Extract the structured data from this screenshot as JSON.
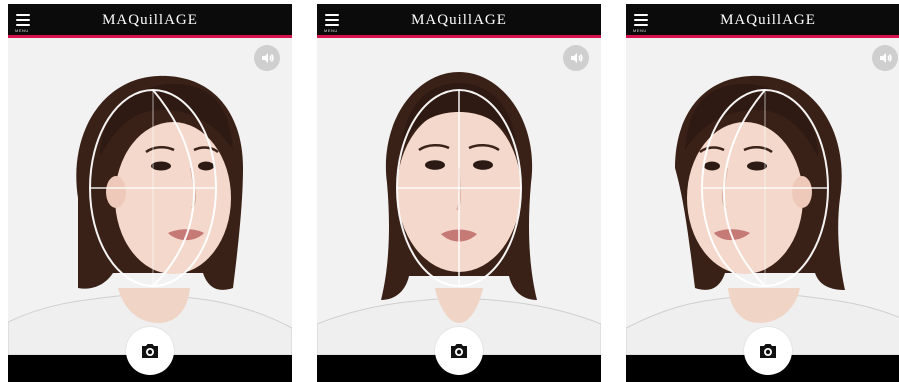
{
  "screens": [
    {
      "brand": "MAQuillAGE",
      "menu_label": "MENU",
      "sound_icon": "speaker-icon",
      "camera_icon": "camera-icon",
      "pose": "turned-left"
    },
    {
      "brand": "MAQuillAGE",
      "menu_label": "MENU",
      "sound_icon": "speaker-icon",
      "camera_icon": "camera-icon",
      "pose": "front"
    },
    {
      "brand": "MAQuillAGE",
      "menu_label": "MENU",
      "sound_icon": "speaker-icon",
      "camera_icon": "camera-icon",
      "pose": "turned-right"
    }
  ],
  "colors": {
    "header_bg": "#0b0b0b",
    "accent_line": "#d6124f",
    "viewport_bg": "#f1f1f1",
    "button_bg": "#ffffff"
  }
}
